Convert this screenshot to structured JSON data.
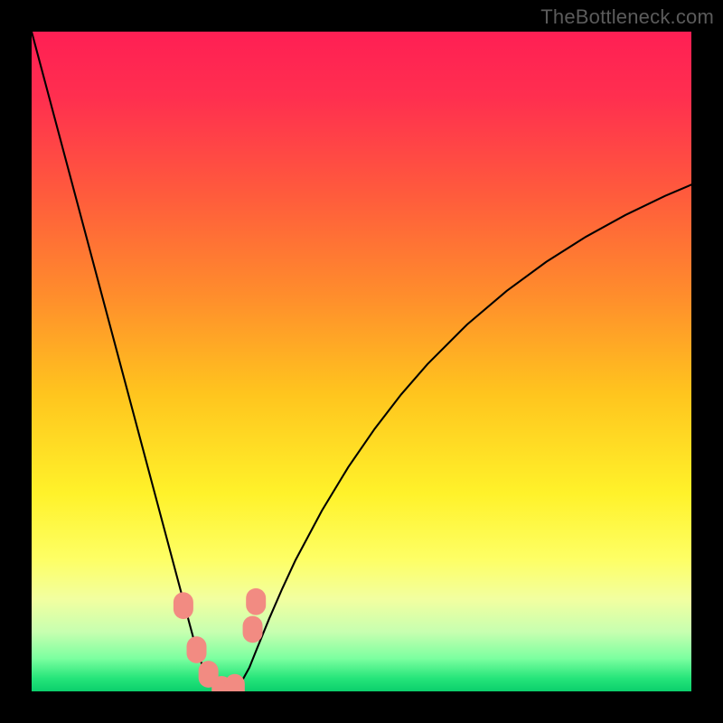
{
  "watermark": "TheBottleneck.com",
  "chart_data": {
    "type": "line",
    "title": "",
    "xlabel": "",
    "ylabel": "",
    "xlim": [
      0,
      100
    ],
    "ylim": [
      0,
      100
    ],
    "grid": false,
    "legend": false,
    "background_gradient": {
      "stops": [
        {
          "offset": 0.0,
          "color": "#ff1f54"
        },
        {
          "offset": 0.1,
          "color": "#ff2f4f"
        },
        {
          "offset": 0.25,
          "color": "#ff5c3c"
        },
        {
          "offset": 0.4,
          "color": "#ff8d2c"
        },
        {
          "offset": 0.55,
          "color": "#ffc51e"
        },
        {
          "offset": 0.7,
          "color": "#fff22a"
        },
        {
          "offset": 0.8,
          "color": "#feff65"
        },
        {
          "offset": 0.86,
          "color": "#f2ffa0"
        },
        {
          "offset": 0.91,
          "color": "#c7ffb0"
        },
        {
          "offset": 0.95,
          "color": "#7cffa0"
        },
        {
          "offset": 0.98,
          "color": "#26e57a"
        },
        {
          "offset": 1.0,
          "color": "#0bcf6c"
        }
      ]
    },
    "series": [
      {
        "name": "bottleneck-curve",
        "color": "#000000",
        "stroke_width": 2.1,
        "x": [
          0,
          2,
          4,
          6,
          8,
          10,
          12,
          14,
          16,
          18,
          20,
          22,
          24,
          25,
          26,
          27,
          28,
          29,
          30,
          31,
          32,
          33,
          34,
          36,
          38,
          40,
          44,
          48,
          52,
          56,
          60,
          66,
          72,
          78,
          84,
          90,
          96,
          100
        ],
        "y": [
          100,
          92.5,
          85,
          77.5,
          70,
          62.5,
          55,
          47.5,
          40,
          32.5,
          25,
          17.5,
          10,
          6.3,
          3.6,
          1.8,
          0.6,
          0.1,
          0.1,
          0.6,
          1.8,
          3.6,
          6.1,
          11.0,
          15.6,
          19.9,
          27.4,
          34.0,
          39.8,
          45.0,
          49.6,
          55.6,
          60.7,
          65.1,
          68.9,
          72.2,
          75.1,
          76.8
        ]
      }
    ],
    "markers": {
      "name": "highlight-points",
      "color": "#f28b82",
      "radius_major": 11,
      "points": [
        {
          "x": 23.0,
          "y": 13.0
        },
        {
          "x": 25.0,
          "y": 6.3
        },
        {
          "x": 26.8,
          "y": 2.6
        },
        {
          "x": 28.8,
          "y": 0.3
        },
        {
          "x": 30.8,
          "y": 0.6
        },
        {
          "x": 33.5,
          "y": 9.4
        },
        {
          "x": 34.0,
          "y": 13.6
        }
      ]
    }
  }
}
